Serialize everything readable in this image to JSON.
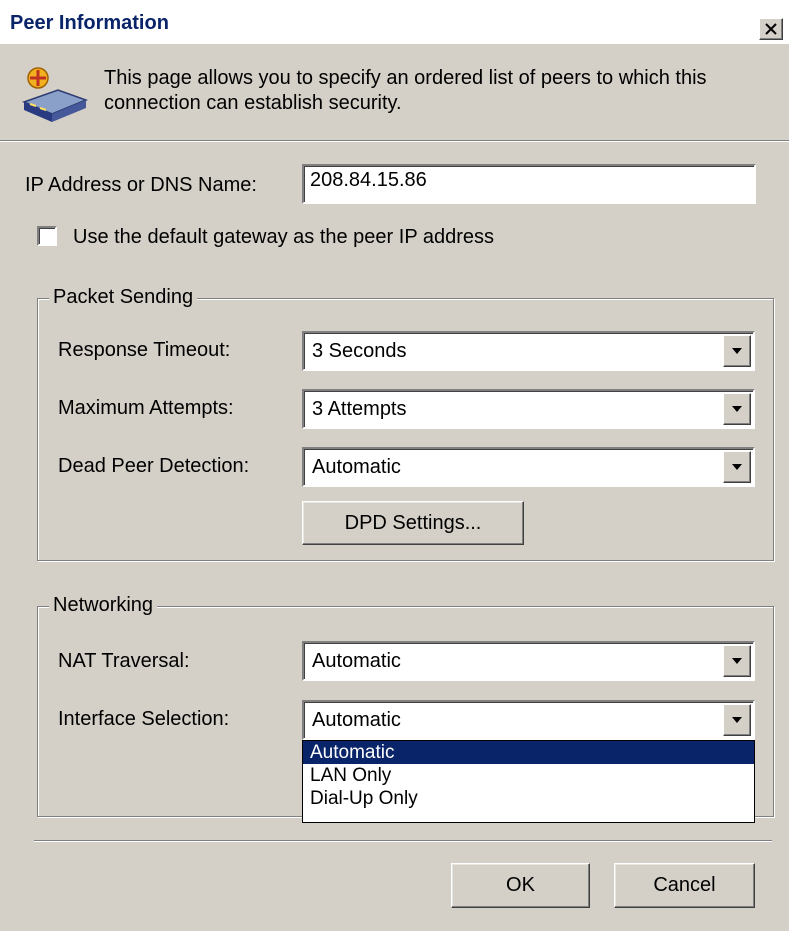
{
  "dialog": {
    "title": "Peer Information",
    "close_icon": "close-x-icon",
    "header_icon": "network-device-icon",
    "description": "This page allows you to specify an ordered list of peers to which this connection can establish security."
  },
  "peer": {
    "ip_label": "IP Address or DNS Name:",
    "ip_value": "208.84.15.86",
    "default_gateway_label": "Use the default gateway as the peer IP address",
    "default_gateway_checked": false
  },
  "packet_sending": {
    "legend": "Packet Sending",
    "response_timeout": {
      "label": "Response Timeout:",
      "value": "3 Seconds"
    },
    "maximum_attempts": {
      "label": "Maximum Attempts:",
      "value": "3 Attempts"
    },
    "dead_peer_detection": {
      "label": "Dead Peer Detection:",
      "value": "Automatic"
    },
    "dpd_button": "DPD Settings..."
  },
  "networking": {
    "legend": "Networking",
    "nat_traversal": {
      "label": "NAT Traversal:",
      "value": "Automatic"
    },
    "interface_selection": {
      "label": "Interface Selection:",
      "value": "Automatic",
      "options": [
        "Automatic",
        "LAN Only",
        "Dial-Up Only"
      ],
      "highlighted": "Automatic"
    }
  },
  "buttons": {
    "ok": "OK",
    "cancel": "Cancel"
  },
  "colors": {
    "face": "#d4d0c8",
    "title_text": "#0a246a",
    "selection": "#0a246a"
  }
}
